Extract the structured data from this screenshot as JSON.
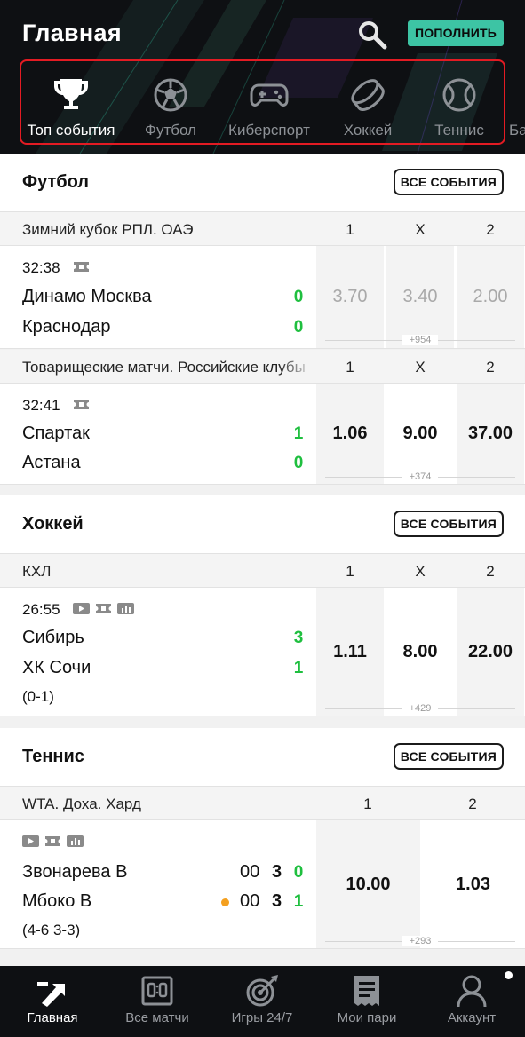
{
  "header": {
    "title": "Главная",
    "topup_label": "ПОПОЛНИТЬ",
    "accent": "#3dc4a4",
    "highlight_border": "#e31b23"
  },
  "sport_tabs": [
    {
      "label": "Топ события",
      "icon": "trophy-icon",
      "active": true
    },
    {
      "label": "Футбол",
      "icon": "soccer-ball-icon",
      "active": false
    },
    {
      "label": "Киберспорт",
      "icon": "gamepad-icon",
      "active": false
    },
    {
      "label": "Хоккей",
      "icon": "hockey-puck-icon",
      "active": false
    },
    {
      "label": "Теннис",
      "icon": "tennis-ball-icon",
      "active": false
    },
    {
      "label": "Ба",
      "icon": "",
      "active": false
    }
  ],
  "sections": {
    "football": {
      "title": "Футбол",
      "all_label": "ВСЕ СОБЫТИЯ",
      "leagues": [
        {
          "name": "Зимний кубок РПЛ. ОАЭ",
          "cols": [
            "1",
            "X",
            "2"
          ],
          "match": {
            "time": "32:38",
            "team1": "Динамо Москва",
            "score1": "0",
            "team2": "Краснодар",
            "score2": "0",
            "odds": [
              "3.70",
              "3.40",
              "2.00"
            ],
            "more": "+954"
          }
        },
        {
          "name": "Товарищеские матчи. Российские клубы",
          "cols": [
            "1",
            "X",
            "2"
          ],
          "match": {
            "time": "32:41",
            "team1": "Спартак",
            "score1": "1",
            "team2": "Астана",
            "score2": "0",
            "odds": [
              "1.06",
              "9.00",
              "37.00"
            ],
            "more": "+374"
          }
        }
      ]
    },
    "hockey": {
      "title": "Хоккей",
      "all_label": "ВСЕ СОБЫТИЯ",
      "league": {
        "name": "КХЛ",
        "cols": [
          "1",
          "X",
          "2"
        ],
        "match": {
          "time": "26:55",
          "team1": "Сибирь",
          "score1": "3",
          "team2": "ХК Сочи",
          "score2": "1",
          "periods": "(0-1)",
          "odds": [
            "1.11",
            "8.00",
            "22.00"
          ],
          "more": "+429"
        }
      }
    },
    "tennis": {
      "title": "Теннис",
      "all_label": "ВСЕ СОБЫТИЯ",
      "league": {
        "name": "WTA. Доха. Хард",
        "cols": [
          "1",
          "2"
        ],
        "match": {
          "player1": "Звонарева В",
          "p1_points": "00",
          "p1_games": "3",
          "p1_sets": "0",
          "player2": "Мбоко В",
          "p2_points": "00",
          "p2_games": "3",
          "p2_sets": "1",
          "sets_detail": "(4-6 3-3)",
          "odds": [
            "10.00",
            "1.03"
          ],
          "more": "+293"
        }
      }
    }
  },
  "bottom_nav": [
    {
      "label": "Главная",
      "icon": "home-arrow-icon",
      "active": true
    },
    {
      "label": "Все матчи",
      "icon": "scoreboard-icon",
      "active": false
    },
    {
      "label": "Игры 24/7",
      "icon": "target-icon",
      "active": false
    },
    {
      "label": "Мои пари",
      "icon": "receipt-icon",
      "active": false
    },
    {
      "label": "Аккаунт",
      "icon": "user-icon",
      "active": false
    }
  ],
  "colors": {
    "score_green": "#1fbf3f",
    "serve_dot": "#f4a020",
    "header_bg": "#0e1013"
  }
}
